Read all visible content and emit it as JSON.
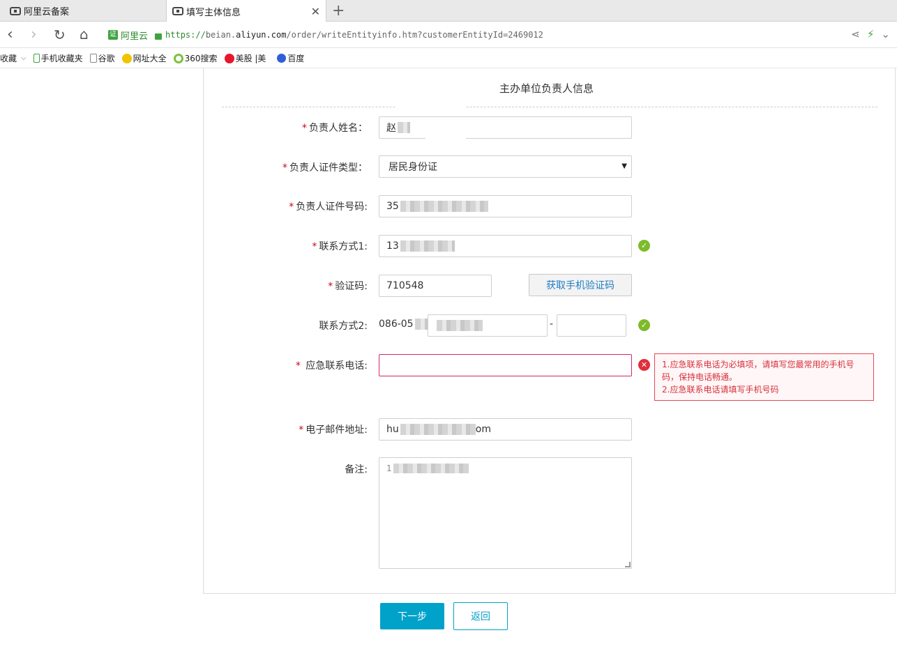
{
  "browser": {
    "tabs": [
      {
        "label": "阿里云备案"
      },
      {
        "label": "填写主体信息"
      }
    ],
    "address": {
      "site_label": "阿里云",
      "url_proto": "https://",
      "url_pre": "beian.",
      "url_domain": "aliyun.com",
      "url_path": "/order/writeEntityinfo.htm?customerEntityId=2469012"
    },
    "bookmarks": [
      {
        "label": "收藏",
        "icon": "bookmark-menu-icon"
      },
      {
        "label": "手机收藏夹",
        "icon": "phone-icon"
      },
      {
        "label": "谷歌",
        "icon": "page-icon"
      },
      {
        "label": "网址大全",
        "icon": "globe-icon"
      },
      {
        "label": "360搜索",
        "icon": "360-icon"
      },
      {
        "label": "美股 |美",
        "icon": "weibo-icon"
      },
      {
        "label": "百度",
        "icon": "baidu-paw-icon"
      }
    ]
  },
  "form": {
    "title": "主办单位负责人信息",
    "fields": {
      "name": {
        "label": "负责人姓名：",
        "value": "赵"
      },
      "id_type": {
        "label": "负责人证件类型：",
        "value": "居民身份证"
      },
      "id_number": {
        "label": "负责人证件号码:",
        "value": "35"
      },
      "contact1": {
        "label": "联系方式1:",
        "value": "13"
      },
      "code": {
        "label": "验证码:",
        "value": "710548"
      },
      "contact2": {
        "label": "联系方式2:",
        "prefix": "086-05",
        "dash": "-"
      },
      "emergency": {
        "label": "应急联系电话:",
        "value": ""
      },
      "email": {
        "label": "电子邮件地址:",
        "value_start": "hu",
        "value_end": "om"
      },
      "remark": {
        "label": "备注:",
        "value": "1"
      }
    },
    "get_code_button": "获取手机验证码",
    "error_lines": [
      "1.应急联系电话为必填项，请填写您最常用的手机号码，保持电话畅通。",
      "2.应急联系电话请填写手机号码"
    ],
    "required_mark": "*",
    "next_button": "下一步",
    "back_button": "返回"
  },
  "colors": {
    "primary": "#00a2ca",
    "error": "#e0303a",
    "success": "#7dbb2a",
    "required": "#d0021b"
  }
}
